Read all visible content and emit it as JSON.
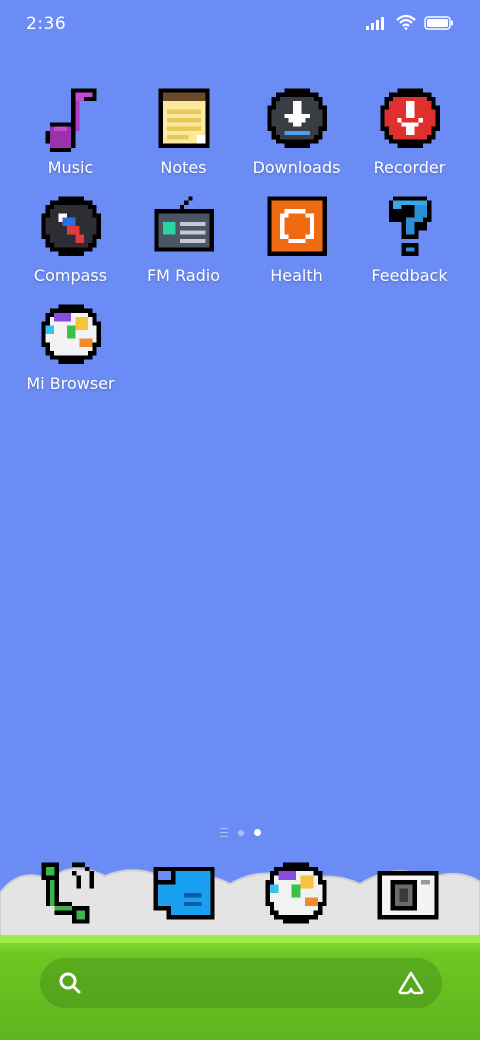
{
  "status": {
    "time": "2:36"
  },
  "apps": [
    {
      "label": "Music"
    },
    {
      "label": "Notes"
    },
    {
      "label": "Downloads"
    },
    {
      "label": "Recorder"
    },
    {
      "label": "Compass"
    },
    {
      "label": "FM Radio"
    },
    {
      "label": "Health"
    },
    {
      "label": "Feedback"
    },
    {
      "label": "Mi Browser"
    }
  ],
  "page_indicator": {
    "pages": 3,
    "current": 3
  },
  "dock": [
    "phone-icon",
    "messages-icon",
    "browser-icon",
    "camera-icon"
  ],
  "colors": {
    "wallpaper": "#6b8cf5",
    "grass": "#6cc823"
  }
}
